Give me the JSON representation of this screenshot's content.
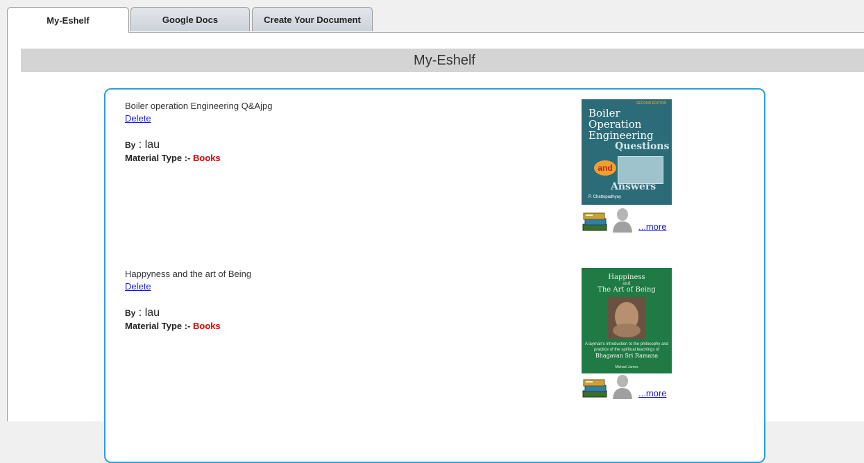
{
  "tabs": [
    {
      "label": "My-Eshelf",
      "active": true
    },
    {
      "label": "Google Docs",
      "active": false
    },
    {
      "label": "Create Your Document",
      "active": false
    }
  ],
  "page_header": "My-Eshelf",
  "items": [
    {
      "title": "Boiler operation Engineering Q&Ajpg",
      "delete_label": "Delete",
      "by_label": "By",
      "by_sep": " : ",
      "author": "lau",
      "material_type_label": "Material Type :- ",
      "material_type": "Books",
      "more_label": "...more",
      "cover": {
        "edition": "SECOND EDITION",
        "title_lines": [
          "Boiler",
          "Operation",
          "Engineering"
        ],
        "questions": "Questions",
        "and": "and",
        "answers": "Answers",
        "author": "P. Chattopadhyay"
      }
    },
    {
      "title": "Happyness and the art of Being",
      "delete_label": "Delete",
      "by_label": "By",
      "by_sep": " : ",
      "author": "lau",
      "material_type_label": "Material Type :- ",
      "material_type": "Books",
      "more_label": "...more",
      "cover": {
        "title_lines": [
          "Happiness",
          "and",
          "The Art of Being"
        ],
        "subtitle": "A layman's introduction to the philosophy and practice of the spiritual teachings of",
        "name": "Bhagavan Sri Ramana",
        "author": "Michael James"
      }
    }
  ],
  "colors": {
    "card_border": "#2a9fe0",
    "material_type": "#e00000",
    "link": "#1a1ae6",
    "header_bg": "#d4d4d4"
  }
}
